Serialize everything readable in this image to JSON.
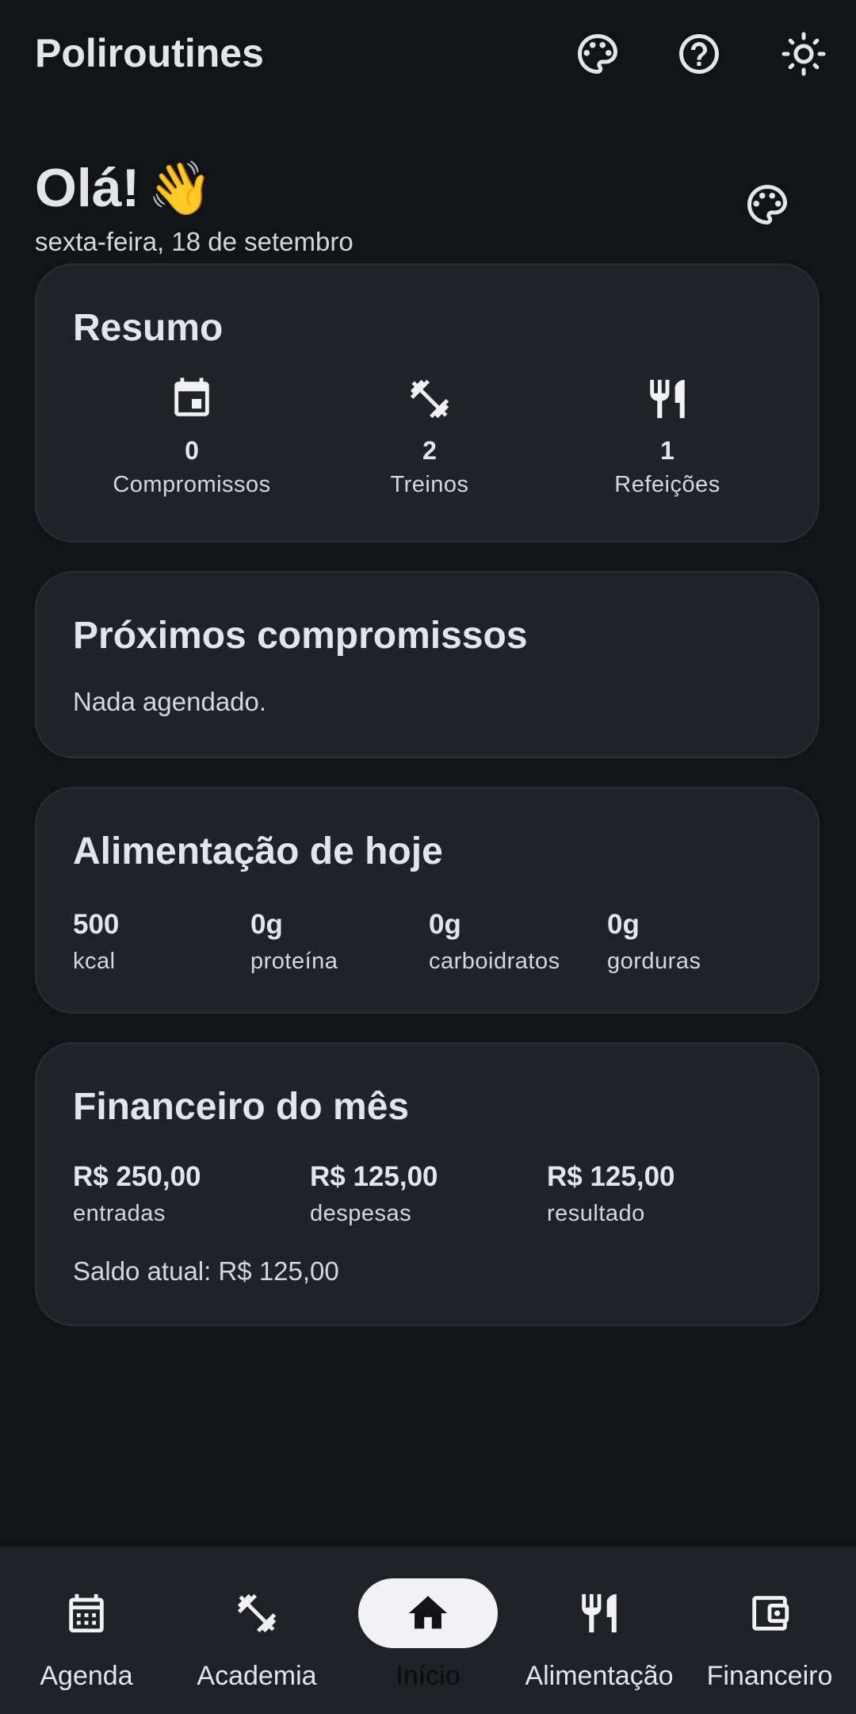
{
  "appbar": {
    "title": "Poliroutines",
    "icons": [
      "palette-icon",
      "help-icon",
      "brightness-icon"
    ]
  },
  "greeting": {
    "hello": "Olá!",
    "emoji": "👋",
    "date": "sexta-feira, 18 de setembro"
  },
  "summary": {
    "title": "Resumo",
    "items": [
      {
        "icon": "calendar-icon",
        "count": "0",
        "label": "Compromissos"
      },
      {
        "icon": "dumbbell-icon",
        "count": "2",
        "label": "Treinos"
      },
      {
        "icon": "restaurant-icon",
        "count": "1",
        "label": "Refeições"
      }
    ]
  },
  "upcoming": {
    "title": "Próximos compromissos",
    "empty": "Nada agendado."
  },
  "nutrition": {
    "title": "Alimentação de hoje",
    "stats": [
      {
        "value": "500",
        "label": "kcal"
      },
      {
        "value": "0g",
        "label": "proteína"
      },
      {
        "value": "0g",
        "label": "carboidratos"
      },
      {
        "value": "0g",
        "label": "gorduras"
      }
    ]
  },
  "finance": {
    "title": "Financeiro do mês",
    "stats": [
      {
        "value": "R$ 250,00",
        "label": "entradas"
      },
      {
        "value": "R$ 125,00",
        "label": "despesas"
      },
      {
        "value": "R$ 125,00",
        "label": "resultado"
      }
    ],
    "balance": "Saldo atual: R$ 125,00"
  },
  "nav": {
    "items": [
      {
        "label": "Agenda",
        "icon": "calendar-month-icon",
        "active": false
      },
      {
        "label": "Academia",
        "icon": "dumbbell-icon",
        "active": false
      },
      {
        "label": "Início",
        "icon": "home-icon",
        "active": true
      },
      {
        "label": "Alimentação",
        "icon": "restaurant-icon",
        "active": false
      },
      {
        "label": "Financeiro",
        "icon": "wallet-icon",
        "active": false
      }
    ]
  },
  "colors": {
    "background": "#111317",
    "card": "#1f2328",
    "nav_background": "#1e2227",
    "active_pill": "#f2f1f6",
    "text": "#e4e5ea"
  }
}
